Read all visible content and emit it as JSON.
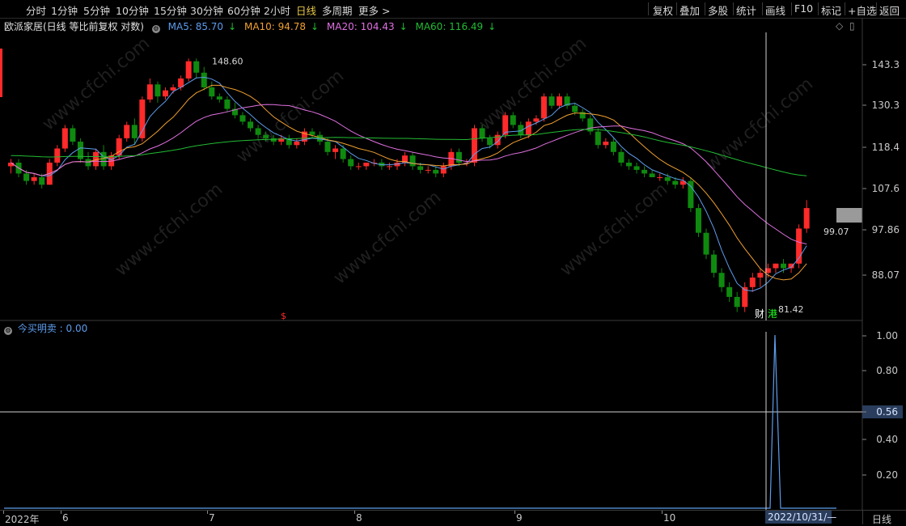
{
  "toolbar": {
    "periods": [
      "分时",
      "1分钟",
      "5分钟",
      "10分钟",
      "15分钟",
      "30分钟",
      "60分钟",
      "2小时",
      "日线",
      "多周期",
      "更多 >"
    ],
    "active_period": "日线",
    "right_buttons": [
      "复权",
      "叠加",
      "多股",
      "统计",
      "画线",
      "F10",
      "标记",
      "+自选",
      "返回"
    ]
  },
  "main_legend": {
    "stock": "欧派家居(日线 等比前复权 对数)",
    "ma5": "MA5: 85.70",
    "ma10": "MA10: 94.78",
    "ma20": "MA20: 104.43",
    "ma60": "MA60: 116.49",
    "arrow": "↓"
  },
  "colors": {
    "up": "#ff2a2a",
    "down": "#0f8a0f",
    "ma5": "#5d9cec",
    "ma10": "#f0a030",
    "ma20": "#e070e0",
    "ma60": "#22bb33",
    "bg": "#000000"
  },
  "main_axis": {
    "labels": [
      "143.3",
      "130.3",
      "118.4",
      "107.6",
      "97.86",
      "88.07"
    ],
    "current_price": "99.07"
  },
  "annotations": {
    "high": "148.60",
    "low": "81.42",
    "event_marks": [
      "财",
      "港"
    ],
    "signal": "$"
  },
  "indicator": {
    "legend": "今买明卖 : 0.00",
    "axis_labels": [
      "1.00",
      "0.80",
      "0.56",
      "0.40",
      "0.20"
    ],
    "hline_value": "0.56"
  },
  "xaxis": {
    "labels": [
      "2022年",
      "6",
      "7",
      "8",
      "9",
      "10"
    ],
    "cursor_date": "2022/10/31/—",
    "period": "日线"
  },
  "watermark": "www.cfchi.com",
  "chart_data": {
    "type": "candlestick",
    "title": "欧派家居(日线 等比前复权 对数)",
    "ohlc": [
      [
        115,
        117,
        113,
        116
      ],
      [
        116,
        117,
        112,
        113
      ],
      [
        113,
        114,
        110,
        111
      ],
      [
        111,
        113,
        110,
        112
      ],
      [
        112,
        113,
        109,
        110
      ],
      [
        110,
        117,
        110,
        116
      ],
      [
        116,
        121,
        115,
        120
      ],
      [
        120,
        127,
        119,
        126
      ],
      [
        126,
        127,
        121,
        122
      ],
      [
        122,
        123,
        116,
        117
      ],
      [
        117,
        119,
        114,
        115
      ],
      [
        115,
        120,
        114,
        119
      ],
      [
        119,
        121,
        114,
        115
      ],
      [
        115,
        119,
        114,
        118
      ],
      [
        118,
        124,
        117,
        123
      ],
      [
        123,
        128,
        122,
        127
      ],
      [
        127,
        129,
        121,
        123
      ],
      [
        123,
        136,
        122,
        135
      ],
      [
        135,
        142,
        134,
        140
      ],
      [
        140,
        141,
        134,
        136
      ],
      [
        136,
        139,
        135,
        138
      ],
      [
        138,
        140,
        137,
        139
      ],
      [
        139,
        143,
        138,
        142
      ],
      [
        142,
        149,
        141,
        148
      ],
      [
        148,
        149,
        142,
        144
      ],
      [
        144,
        146,
        138,
        139
      ],
      [
        139,
        141,
        135,
        136
      ],
      [
        136,
        137,
        134,
        135
      ],
      [
        135,
        136,
        131,
        132
      ],
      [
        132,
        134,
        129,
        130
      ],
      [
        130,
        131,
        127,
        128
      ],
      [
        128,
        129,
        125,
        126
      ],
      [
        126,
        127,
        123,
        124
      ],
      [
        124,
        125,
        122,
        123
      ],
      [
        123,
        124,
        121,
        122
      ],
      [
        122,
        124,
        121,
        123
      ],
      [
        123,
        124,
        120,
        121
      ],
      [
        121,
        123,
        120,
        122
      ],
      [
        122,
        126,
        121,
        125
      ],
      [
        125,
        126,
        123,
        124
      ],
      [
        124,
        125,
        121,
        122
      ],
      [
        122,
        123,
        118,
        119
      ],
      [
        119,
        121,
        117,
        120
      ],
      [
        120,
        121,
        116,
        117
      ],
      [
        117,
        118,
        114,
        115
      ],
      [
        115,
        116,
        114,
        115
      ],
      [
        115,
        116,
        114,
        116
      ],
      [
        116,
        117,
        115,
        116
      ],
      [
        116,
        117,
        114,
        115
      ],
      [
        115,
        116,
        114,
        115
      ],
      [
        115,
        117,
        114,
        116
      ],
      [
        116,
        119,
        115,
        118
      ],
      [
        118,
        119,
        114,
        115
      ],
      [
        115,
        116,
        113,
        114
      ],
      [
        114,
        115,
        113,
        114
      ],
      [
        114,
        115,
        112,
        113
      ],
      [
        113,
        116,
        112,
        115
      ],
      [
        115,
        120,
        114,
        119
      ],
      [
        119,
        120,
        115,
        116
      ],
      [
        116,
        117,
        115,
        116
      ],
      [
        116,
        127,
        115,
        126
      ],
      [
        126,
        127,
        122,
        123
      ],
      [
        123,
        124,
        120,
        121
      ],
      [
        121,
        125,
        120,
        124
      ],
      [
        124,
        131,
        123,
        130
      ],
      [
        130,
        131,
        126,
        127
      ],
      [
        127,
        128,
        123,
        124
      ],
      [
        124,
        129,
        123,
        128
      ],
      [
        128,
        130,
        127,
        129
      ],
      [
        129,
        137,
        128,
        136
      ],
      [
        136,
        137,
        132,
        133
      ],
      [
        133,
        137,
        132,
        136
      ],
      [
        136,
        137,
        132,
        133
      ],
      [
        133,
        134,
        130,
        131
      ],
      [
        131,
        132,
        128,
        129
      ],
      [
        129,
        130,
        124,
        125
      ],
      [
        125,
        126,
        120,
        121
      ],
      [
        121,
        123,
        120,
        122
      ],
      [
        122,
        123,
        118,
        119
      ],
      [
        119,
        120,
        115,
        116
      ],
      [
        116,
        117,
        114,
        115
      ],
      [
        115,
        116,
        113,
        114
      ],
      [
        114,
        115,
        112,
        113
      ],
      [
        113,
        114,
        112,
        112
      ],
      [
        112,
        113,
        111,
        112
      ],
      [
        112,
        113,
        110,
        111
      ],
      [
        111,
        112,
        109,
        110
      ],
      [
        110,
        112,
        109,
        111
      ],
      [
        111,
        112,
        103,
        104
      ],
      [
        104,
        105,
        97,
        98
      ],
      [
        98,
        99,
        92,
        93
      ],
      [
        93,
        94,
        88,
        89
      ],
      [
        89,
        90,
        85,
        86
      ],
      [
        86,
        87,
        83,
        84
      ],
      [
        84,
        85,
        81,
        82
      ],
      [
        82,
        87,
        81,
        86
      ],
      [
        86,
        89,
        85,
        88
      ],
      [
        88,
        90,
        86,
        89
      ],
      [
        89,
        91,
        88,
        90
      ],
      [
        90,
        91,
        89,
        91
      ],
      [
        91,
        92,
        89,
        90
      ],
      [
        90,
        91,
        89,
        91
      ],
      [
        91,
        100,
        90,
        99
      ],
      [
        99,
        106,
        98,
        104
      ]
    ],
    "ma": {
      "MA5": 85.7,
      "MA10": 94.78,
      "MA20": 104.43,
      "MA60": 116.49
    },
    "indicator_series": {
      "name": "今买明卖",
      "spike_index": 98,
      "values_note": "0 except spike to 1.00"
    },
    "ylim": [
      81,
      150
    ],
    "scale": "log"
  }
}
